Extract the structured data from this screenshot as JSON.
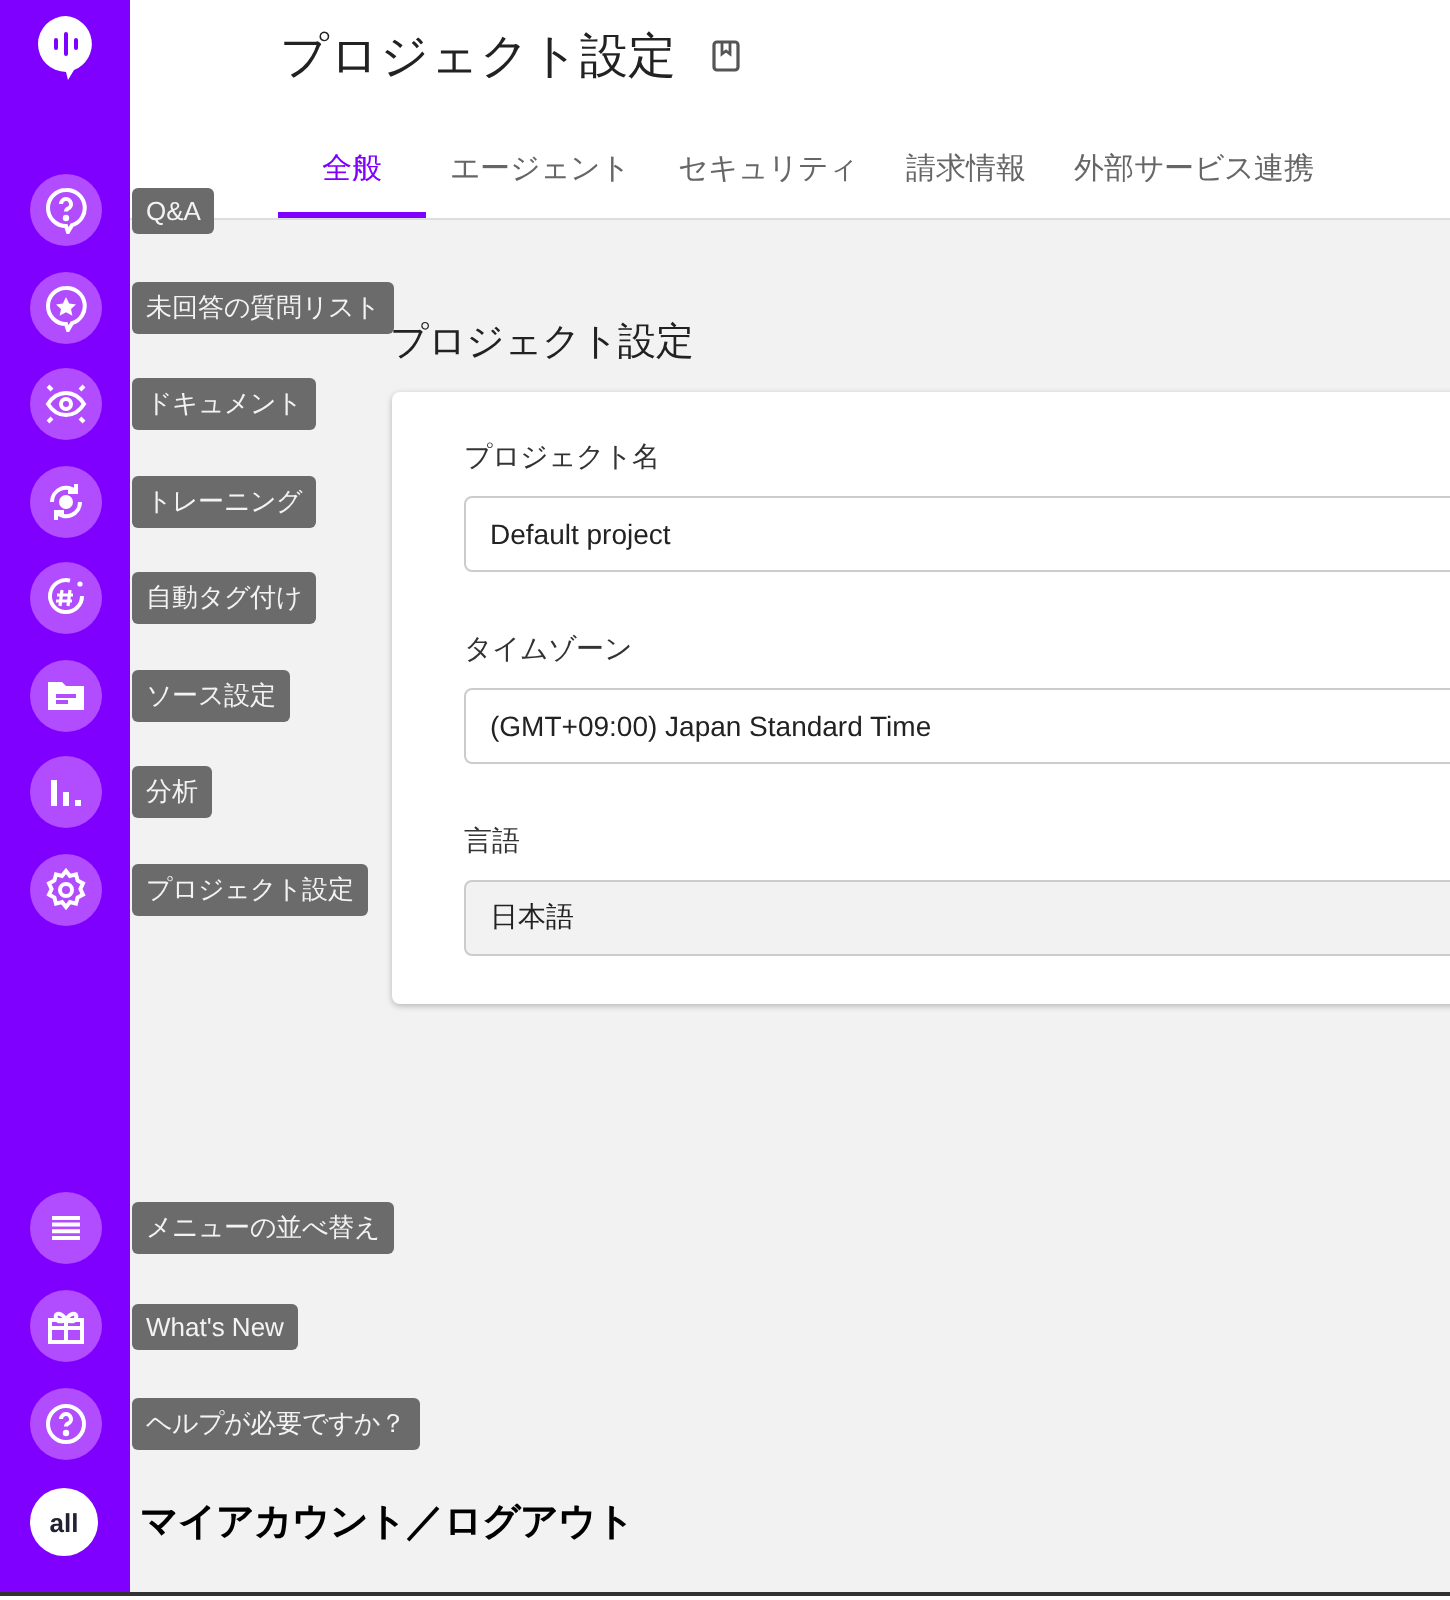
{
  "nav_items": [
    {
      "label": "Q&A"
    },
    {
      "label": "未回答の質問リスト"
    },
    {
      "label": "ドキュメント"
    },
    {
      "label": "トレーニング"
    },
    {
      "label": "自動タグ付け"
    },
    {
      "label": "ソース設定"
    },
    {
      "label": "分析"
    },
    {
      "label": "プロジェクト設定"
    }
  ],
  "bottom_items": [
    {
      "label": "メニューの並べ替え"
    },
    {
      "label": "What's New"
    },
    {
      "label": "ヘルプが必要ですか？"
    }
  ],
  "account": {
    "logo": "all",
    "label": "マイアカウント／ログアウト"
  },
  "page_title": "プロジェクト設定",
  "tabs": [
    {
      "label": "全般",
      "selected": true
    },
    {
      "label": "エージェント",
      "selected": false
    },
    {
      "label": "セキュリティ",
      "selected": false
    },
    {
      "label": "請求情報",
      "selected": false
    },
    {
      "label": "外部サービス連携",
      "selected": false
    }
  ],
  "section_title": "プロジェクト設定",
  "fields": [
    {
      "label": "プロジェクト名",
      "value": "Default project",
      "disabled": false
    },
    {
      "label": "タイムゾーン",
      "value": "(GMT+09:00) Japan Standard Time",
      "disabled": false
    },
    {
      "label": "言語",
      "value": "日本語",
      "disabled": true
    }
  ]
}
